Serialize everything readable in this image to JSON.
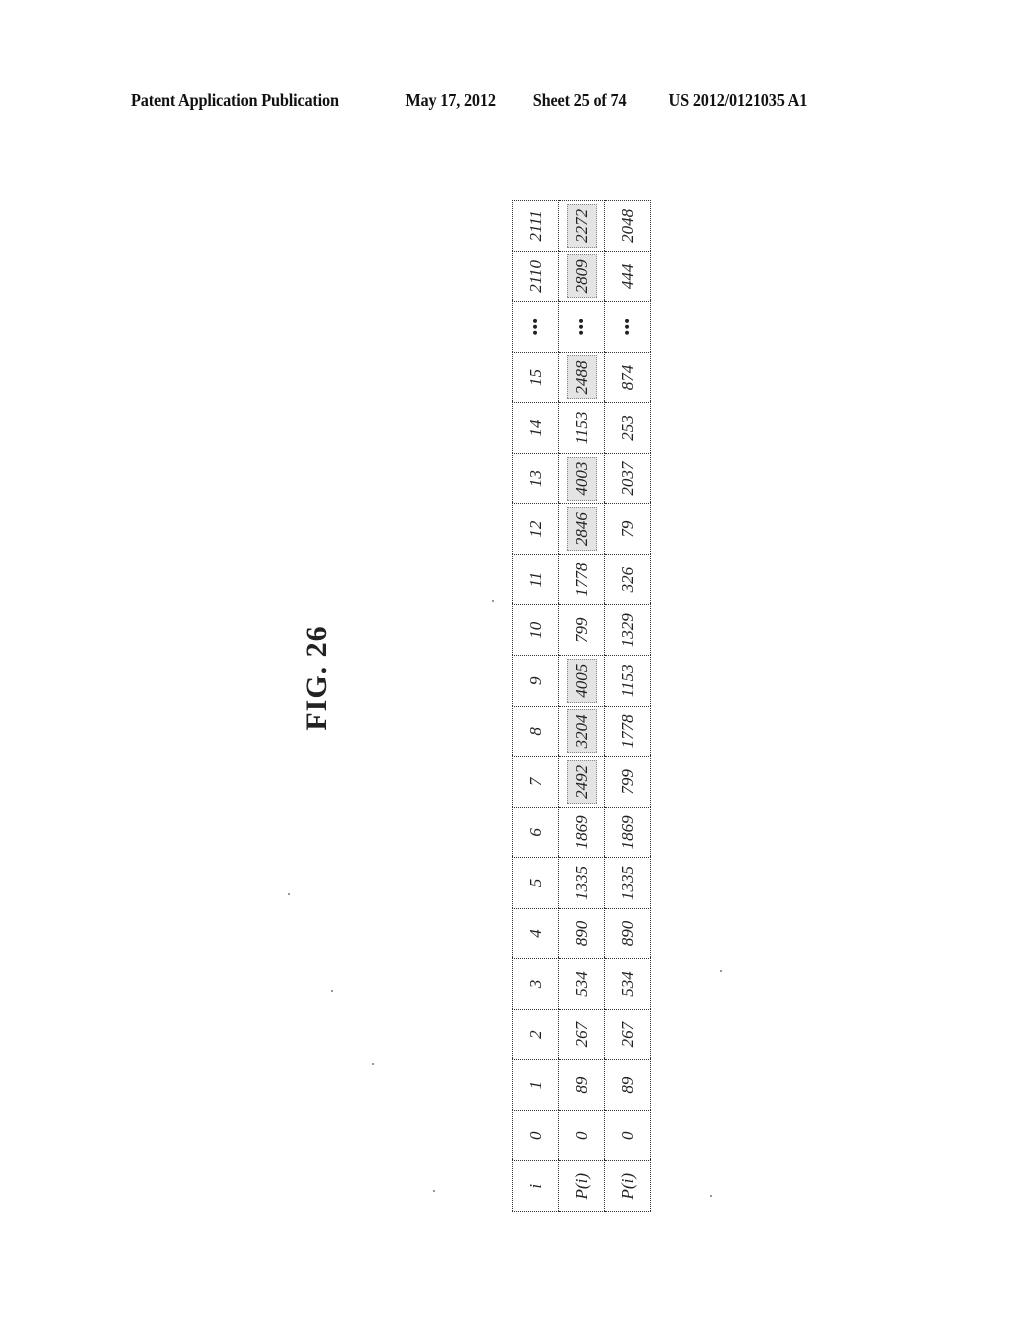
{
  "header": {
    "publication": "Patent Application Publication",
    "date": "May 17, 2012",
    "sheet": "Sheet 25 of 74",
    "number": "US 2012/0121035 A1"
  },
  "figure": {
    "label": "FIG. 26"
  },
  "table": {
    "row_labels": [
      "i",
      "P(i)",
      "P(i)"
    ],
    "columns": [
      {
        "i": "0",
        "p1": "0",
        "p1_shaded": false,
        "p2": "0"
      },
      {
        "i": "1",
        "p1": "89",
        "p1_shaded": false,
        "p2": "89"
      },
      {
        "i": "2",
        "p1": "267",
        "p1_shaded": false,
        "p2": "267"
      },
      {
        "i": "3",
        "p1": "534",
        "p1_shaded": false,
        "p2": "534"
      },
      {
        "i": "4",
        "p1": "890",
        "p1_shaded": false,
        "p2": "890"
      },
      {
        "i": "5",
        "p1": "1335",
        "p1_shaded": false,
        "p2": "1335"
      },
      {
        "i": "6",
        "p1": "1869",
        "p1_shaded": false,
        "p2": "1869"
      },
      {
        "i": "7",
        "p1": "2492",
        "p1_shaded": true,
        "p2": "799"
      },
      {
        "i": "8",
        "p1": "3204",
        "p1_shaded": true,
        "p2": "1778"
      },
      {
        "i": "9",
        "p1": "4005",
        "p1_shaded": true,
        "p2": "1153"
      },
      {
        "i": "10",
        "p1": "799",
        "p1_shaded": false,
        "p2": "1329"
      },
      {
        "i": "11",
        "p1": "1778",
        "p1_shaded": false,
        "p2": "326"
      },
      {
        "i": "12",
        "p1": "2846",
        "p1_shaded": true,
        "p2": "79"
      },
      {
        "i": "13",
        "p1": "4003",
        "p1_shaded": true,
        "p2": "2037"
      },
      {
        "i": "14",
        "p1": "1153",
        "p1_shaded": false,
        "p2": "253"
      },
      {
        "i": "15",
        "p1": "2488",
        "p1_shaded": true,
        "p2": "874"
      },
      {
        "i": "•••",
        "p1": "•••",
        "p1_shaded": false,
        "p2": "•••"
      },
      {
        "i": "2110",
        "p1": "2809",
        "p1_shaded": true,
        "p2": "444"
      },
      {
        "i": "2111",
        "p1": "2272",
        "p1_shaded": true,
        "p2": "2048"
      }
    ]
  }
}
